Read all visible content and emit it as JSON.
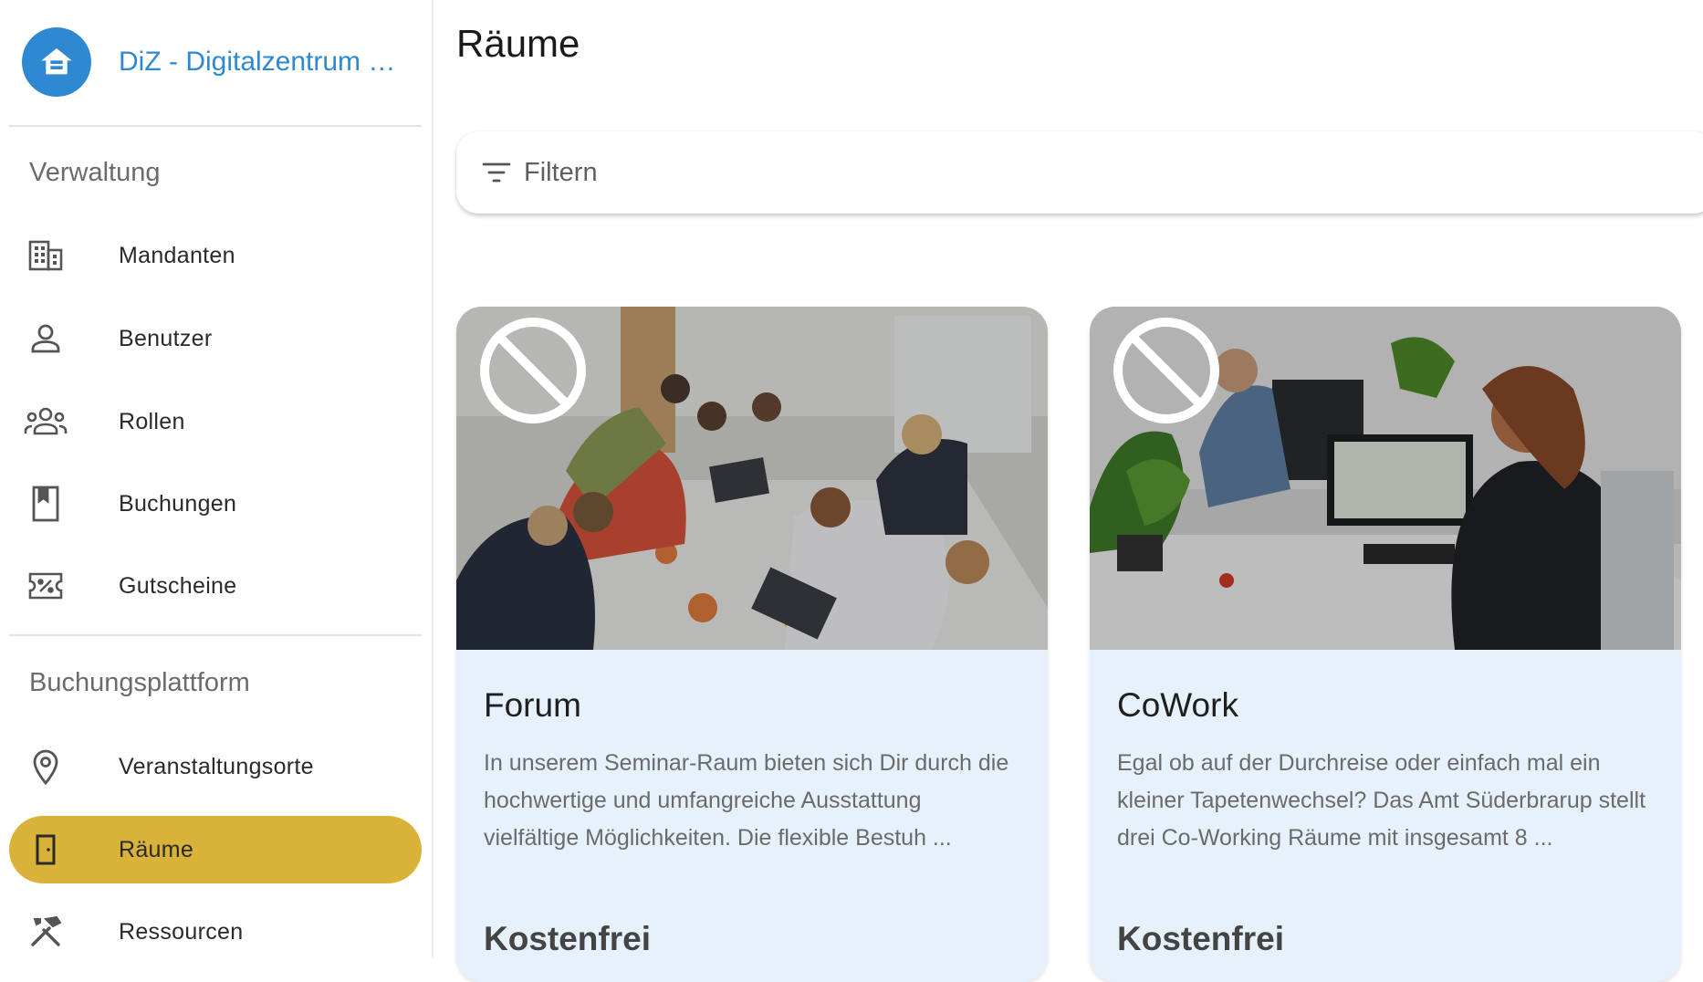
{
  "brand": {
    "title": "DiZ - Digitalzentrum Süderbrarup",
    "logo_icon": "home-icon",
    "color": "#2f88d2"
  },
  "sidebar": {
    "sections": [
      {
        "title": "Verwaltung",
        "items": [
          {
            "label": "Mandanten",
            "icon": "building-icon"
          },
          {
            "label": "Benutzer",
            "icon": "person-icon"
          },
          {
            "label": "Rollen",
            "icon": "group-icon"
          },
          {
            "label": "Buchungen",
            "icon": "bookmark-icon"
          },
          {
            "label": "Gutscheine",
            "icon": "voucher-icon"
          }
        ]
      },
      {
        "title": "Buchungsplattform",
        "items": [
          {
            "label": "Veranstaltungsorte",
            "icon": "location-pin-icon"
          },
          {
            "label": "Räume",
            "icon": "door-icon",
            "active": true
          },
          {
            "label": "Ressourcen",
            "icon": "tools-icon"
          }
        ]
      }
    ],
    "active_color": "#d9b23a"
  },
  "main": {
    "title": "Räume",
    "filter": {
      "label": "Filtern",
      "icon": "filter-icon"
    },
    "cards": [
      {
        "title": "Forum",
        "description": "In unserem Seminar-Raum bieten sich Dir durch die hochwertige und umfangreiche Ausstattung vielfältige Möglichkeiten. Die flexible Bestuh ...",
        "price": "Kostenfrei",
        "badge_icon": "unavailable-icon"
      },
      {
        "title": "CoWork",
        "description": "Egal ob auf der Durchreise oder einfach mal ein kleiner Tapetenwechsel? Das Amt Süderbrarup stellt drei Co-Working Räume mit insgesamt 8 ...",
        "price": "Kostenfrei",
        "badge_icon": "unavailable-icon"
      }
    ],
    "card_background": "#e6f1fb"
  }
}
